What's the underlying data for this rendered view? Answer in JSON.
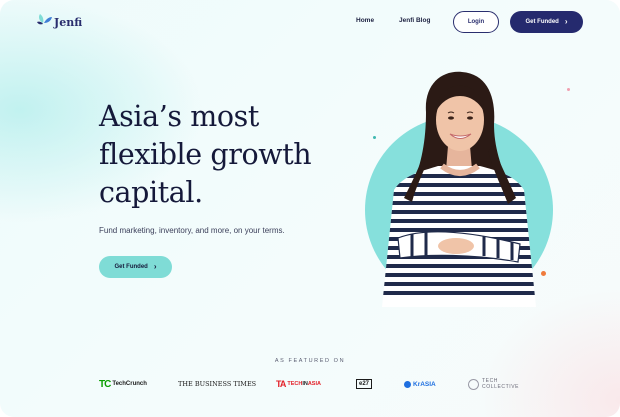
{
  "brand": {
    "name": "Jenfi"
  },
  "nav": {
    "home": "Home",
    "blog": "Jenfi Blog",
    "login": "Login",
    "cta": "Get Funded"
  },
  "hero": {
    "title_line1": "Asia’s most",
    "title_line2": "flexible growth",
    "title_line3": "capital.",
    "subtitle": "Fund marketing, inventory, and more, on your terms.",
    "cta": "Get Funded"
  },
  "featured": {
    "label": "AS FEATURED ON",
    "logos": [
      {
        "name": "techcrunch",
        "mark": "TC",
        "text": "TechCrunch"
      },
      {
        "name": "business-times",
        "text": "THE BUSINESS TIMES"
      },
      {
        "name": "tech-in-asia",
        "mark": "TA",
        "text": "TECH",
        "accent": "IN",
        "text2": "ASIA"
      },
      {
        "name": "e27",
        "text": "e27"
      },
      {
        "name": "kr-asia",
        "text": "KrASIA"
      },
      {
        "name": "tech-collective",
        "text": "TECH",
        "text2": "COLLECTIVE"
      }
    ]
  },
  "colors": {
    "navy": "#252a6e",
    "teal": "#7fdcd6",
    "circle": "#86e0dc",
    "dot_orange": "#f07b3c",
    "dot_teal": "#3fb8b0",
    "dot_pink": "#f0a0b0"
  }
}
